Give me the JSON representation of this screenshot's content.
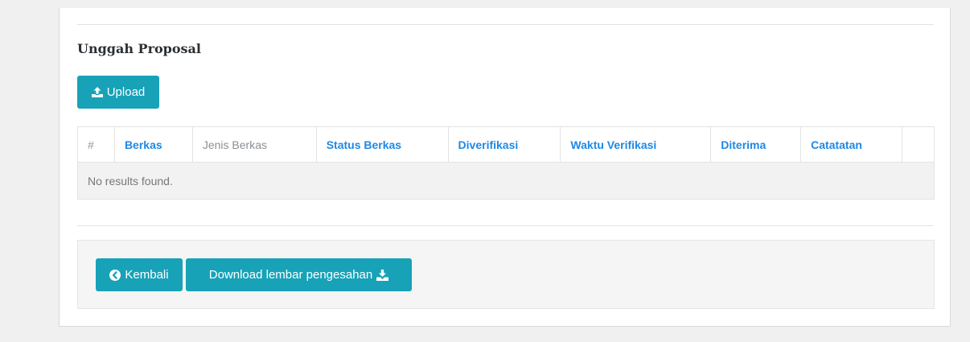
{
  "section": {
    "title": "Unggah Proposal"
  },
  "upload_button": {
    "label": "Upload",
    "icon": "upload-icon"
  },
  "table": {
    "columns": [
      {
        "label": "#",
        "sortable": false
      },
      {
        "label": "Berkas",
        "sortable": true
      },
      {
        "label": "Jenis Berkas",
        "sortable": false
      },
      {
        "label": "Status Berkas",
        "sortable": true
      },
      {
        "label": "Diverifikasi",
        "sortable": true
      },
      {
        "label": "Waktu Verifikasi",
        "sortable": true
      },
      {
        "label": "Diterima",
        "sortable": true
      },
      {
        "label": "Catatatan",
        "sortable": true
      },
      {
        "label": "",
        "sortable": false
      }
    ],
    "empty_message": "No results found."
  },
  "footer": {
    "back_label": "Kembali",
    "back_icon": "arrow-circle-left-icon",
    "download_label": "Download lembar pengesahan",
    "download_icon": "download-icon"
  },
  "colors": {
    "button": "#17a2b8",
    "link": "#1e88e5",
    "panel_bg": "#ffffff",
    "page_bg": "#f0f0f0"
  }
}
